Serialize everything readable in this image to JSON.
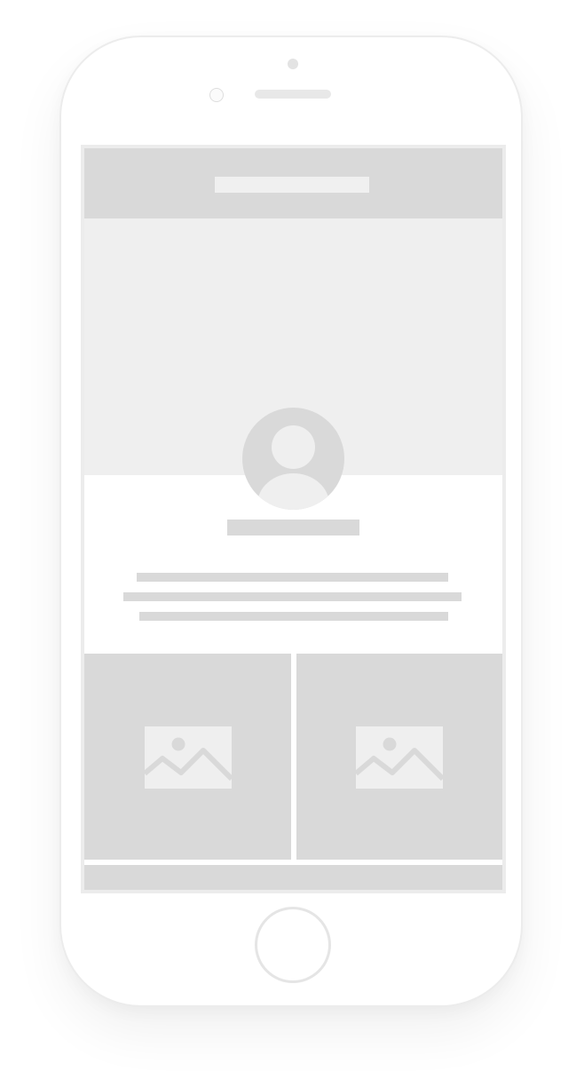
{
  "device": {
    "type": "smartphone wireframe",
    "frame_color": "#ffffff",
    "placeholder_color": "#d9d9d9",
    "background_tint": "#efefef"
  },
  "screen": {
    "nav_bar": {
      "title": ""
    },
    "profile": {
      "avatar_icon": "user-avatar-icon",
      "name": "",
      "bio_lines": [
        "",
        "",
        ""
      ]
    },
    "gallery": {
      "tiles": [
        {
          "icon": "image-placeholder-icon"
        },
        {
          "icon": "image-placeholder-icon"
        }
      ]
    },
    "footer": {
      "text": ""
    }
  }
}
